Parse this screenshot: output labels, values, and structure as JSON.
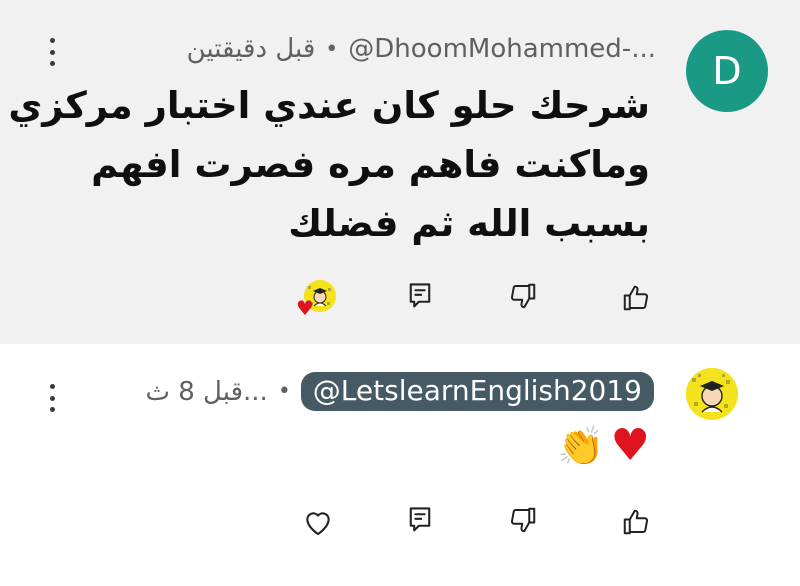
{
  "comments": [
    {
      "avatar_letter": "D",
      "author": "@DhoomMohammed-...",
      "time": "قبل دقيقتين",
      "separator": "•",
      "body_lines": [
        "شرحك حلو كان عندي اختبار مركزي",
        "وماكنت فاهم مره فصرت افهم",
        "بسبب الله ثم فضلك"
      ],
      "creator_heart": true
    },
    {
      "author": "@LetslearnEnglish2019",
      "time": "قبل 8 ث...",
      "separator": "•",
      "body_emoji": [
        "♥",
        "👏"
      ],
      "author_highlighted": true
    }
  ],
  "colors": {
    "avatar_d": "#1a9a85",
    "thread_bg": "#f1f1f1",
    "creator_pill": "#455a64",
    "heart": "#e0141e",
    "avatar_yellow": "#f3e21c"
  },
  "icons": [
    "more-vert-icon",
    "like-icon",
    "dislike-icon",
    "reply-icon",
    "heart-outline-icon",
    "creator-heart-badge"
  ]
}
